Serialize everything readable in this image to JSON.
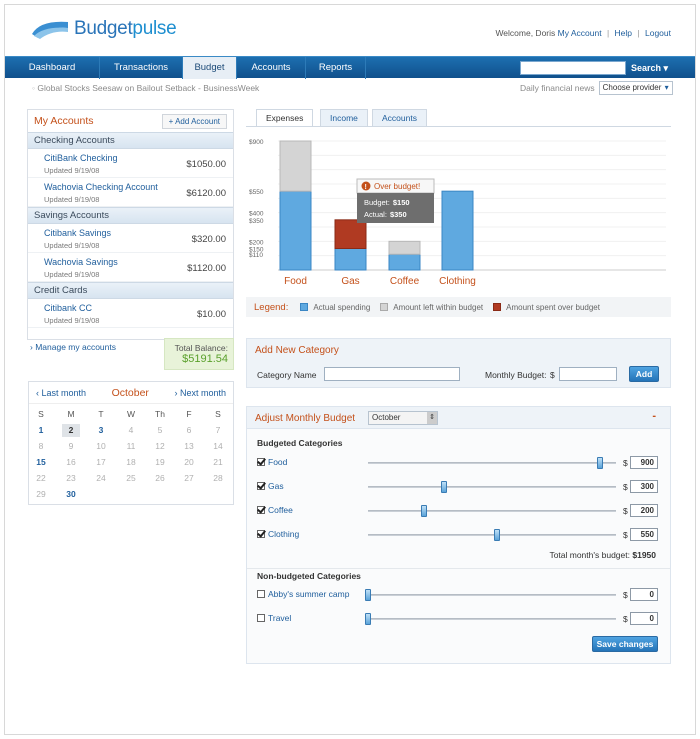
{
  "app": {
    "logo_text": "Budgetpulse",
    "logo_text_a": "Budget",
    "logo_text_b": "pulse"
  },
  "header": {
    "welcome": "Welcome, Doris",
    "my_account": "My Account",
    "help": "Help",
    "logout": "Logout",
    "separator": "|"
  },
  "nav": {
    "tabs": [
      "Dashboard",
      "Transactions",
      "Budget",
      "Accounts",
      "Reports"
    ],
    "active": "Budget",
    "search_label": "Search",
    "search_value": ""
  },
  "news": {
    "ticker": "Global Stocks Seesaw on Bailout Setback - BusinessWeek",
    "label": "Daily financial news",
    "provider": "Choose provider"
  },
  "accounts": {
    "title": "My Accounts",
    "add_button": "+ Add Account",
    "sections": [
      {
        "title": "Checking Accounts",
        "items": [
          {
            "name": "CitiBank Checking",
            "updated": "Updated 9/19/08",
            "amount": "$1050.00"
          },
          {
            "name": "Wachovia Checking Account",
            "updated": "Updated 9/19/08",
            "amount": "$6120.00"
          }
        ]
      },
      {
        "title": "Savings Accounts",
        "items": [
          {
            "name": "Citibank Savings",
            "updated": "Updated 9/19/08",
            "amount": "$320.00"
          },
          {
            "name": "Wachovia Savings",
            "updated": "Updated 9/19/08",
            "amount": "$1120.00"
          }
        ]
      },
      {
        "title": "Credit Cards",
        "items": [
          {
            "name": "Citibank CC",
            "updated": "Updated 9/19/08",
            "amount": "$10.00"
          }
        ]
      }
    ],
    "manage_link": "Manage my accounts",
    "total_label": "Total Balance:",
    "total_value": "$5191.54"
  },
  "calendar": {
    "prev": "Last month",
    "next": "Next month",
    "month": "October",
    "weekdays": [
      "S",
      "M",
      "T",
      "W",
      "Th",
      "F",
      "S"
    ],
    "weeks": [
      [
        "1",
        "2",
        "3",
        "4",
        "5",
        "6",
        "7"
      ],
      [
        "8",
        "9",
        "10",
        "11",
        "12",
        "13",
        "14"
      ],
      [
        "15",
        "16",
        "17",
        "18",
        "19",
        "20",
        "21"
      ],
      [
        "22",
        "23",
        "24",
        "25",
        "26",
        "27",
        "28"
      ],
      [
        "29",
        "30",
        "",
        "",
        "",
        "",
        ""
      ]
    ],
    "today": "2",
    "highlighted": [
      "1",
      "3",
      "15",
      "30"
    ]
  },
  "chart_tabs": [
    "Expenses",
    "Income",
    "Accounts"
  ],
  "chart_data": {
    "type": "bar",
    "categories": [
      "Food",
      "Gas",
      "Coffee",
      "Clothing"
    ],
    "y_ticks": [
      "$900",
      "$550",
      "$400",
      "$350",
      "$200",
      "$150",
      "$110"
    ],
    "series": [
      {
        "name": "Actual spending",
        "values": [
          550,
          150,
          110,
          550
        ]
      },
      {
        "name": "Amount left within budget",
        "values": [
          350,
          0,
          90,
          0
        ]
      },
      {
        "name": "Amount spent over budget",
        "values": [
          0,
          200,
          0,
          0
        ]
      }
    ],
    "tooltip": {
      "title": "Over budget!",
      "budget_label": "Budget:",
      "budget": "$150",
      "actual_label": "Actual:",
      "actual": "$350"
    },
    "legend_title": "Legend:",
    "colors": [
      "#5fa9e0",
      "#d4d4d4",
      "#b03a22"
    ]
  },
  "add_category": {
    "title": "Add New Category",
    "name_label": "Category Name",
    "name_value": "",
    "budget_label": "Monthly Budget:",
    "currency": "$",
    "budget_value": "",
    "button": "Add"
  },
  "adjust": {
    "title": "Adjust Monthly Budget",
    "month": "October",
    "collapse": "-",
    "budgeted_title": "Budgeted Categories",
    "budgeted": [
      {
        "name": "Food",
        "value": "900",
        "checked": true,
        "level": 0.95
      },
      {
        "name": "Gas",
        "value": "300",
        "checked": true,
        "level": 0.31
      },
      {
        "name": "Coffee",
        "value": "200",
        "checked": true,
        "level": 0.23
      },
      {
        "name": "Clothing",
        "value": "550",
        "checked": true,
        "level": 0.53
      }
    ],
    "total_label": "Total month's budget:",
    "total_value": "$1950",
    "non_budgeted_title": "Non-budgeted Categories",
    "non_budgeted": [
      {
        "name": "Abby's summer camp",
        "value": "0",
        "checked": false,
        "level": 0
      },
      {
        "name": "Travel",
        "value": "0",
        "checked": false,
        "level": 0
      }
    ],
    "currency": "$",
    "save": "Save changes"
  }
}
